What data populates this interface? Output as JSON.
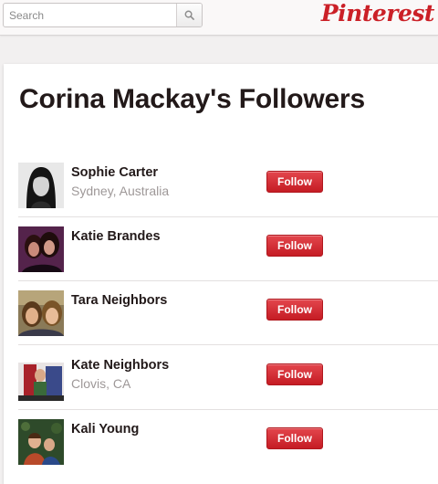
{
  "search": {
    "placeholder": "Search",
    "icon": "magnifier-icon"
  },
  "brand": {
    "logo_text": "Pinterest",
    "color": "#cb2027"
  },
  "page": {
    "title": "Corina Mackay's Followers"
  },
  "followers": [
    {
      "name": "Sophie Carter",
      "location": "Sydney, Australia",
      "button": "Follow"
    },
    {
      "name": "Katie Brandes",
      "location": "",
      "button": "Follow"
    },
    {
      "name": "Tara Neighbors",
      "location": "",
      "button": "Follow"
    },
    {
      "name": "Kate Neighbors",
      "location": "Clovis, CA",
      "button": "Follow"
    },
    {
      "name": "Kali Young",
      "location": "",
      "button": "Follow"
    }
  ]
}
